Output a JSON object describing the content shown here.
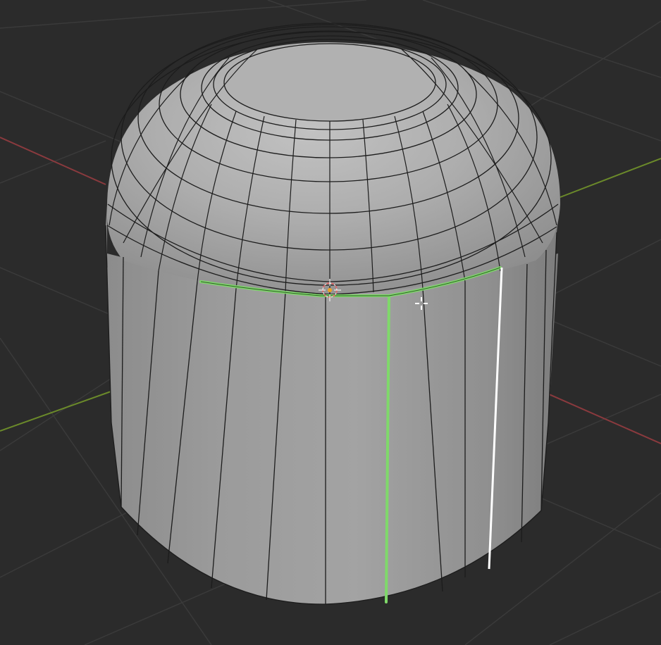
{
  "viewport": {
    "background_color": "#2b2b2b",
    "grid_color": "#3a3a3a",
    "x_axis_color": "#8a3a3e",
    "y_axis_color": "#6b8a2a"
  },
  "object": {
    "type": "mesh",
    "shape": "capped cylinder",
    "face_color": "#9a9a9a",
    "wire_color": "#1c1c1c",
    "selected_edge_color": "#7fd96a",
    "highlighted_edge_color": "#ffffff"
  },
  "cursor": {
    "icon": "crosshair-cursor-icon"
  },
  "origin": {
    "icon": "3d-cursor-icon"
  }
}
